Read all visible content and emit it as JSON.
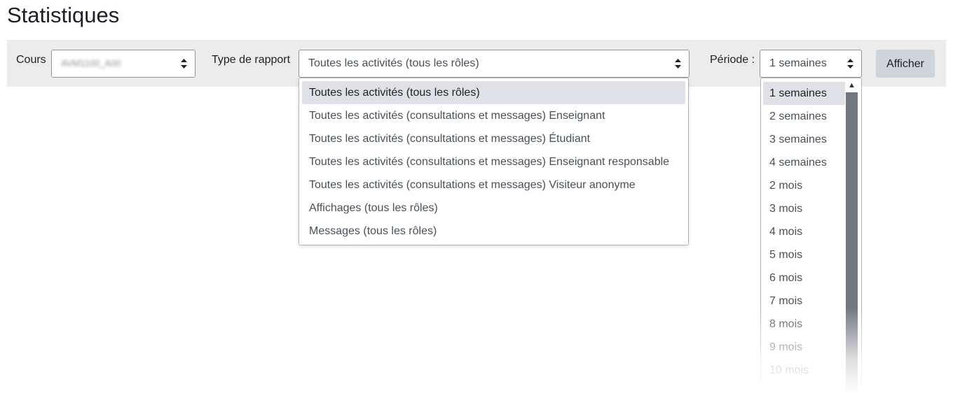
{
  "page": {
    "title": "Statistiques"
  },
  "form": {
    "course_label": "Cours",
    "course_value": "AVM1100_A00",
    "report_type_label": "Type de rapport",
    "report_type_value": "Toutes les activités (tous les rôles)",
    "period_label": "Période :",
    "period_value": "1 semaines",
    "submit_label": "Afficher"
  },
  "report_type_options": [
    "Toutes les activités (tous les rôles)",
    "Toutes les activités (consultations et messages) Enseignant",
    "Toutes les activités (consultations et messages) Étudiant",
    "Toutes les activités (consultations et messages) Enseignant responsable",
    "Toutes les activités (consultations et messages) Visiteur anonyme",
    "Affichages (tous les rôles)",
    "Messages (tous les rôles)"
  ],
  "period_options": [
    "1 semaines",
    "2 semaines",
    "3 semaines",
    "4 semaines",
    "2 mois",
    "3 mois",
    "4 mois",
    "5 mois",
    "6 mois",
    "7 mois",
    "8 mois",
    "9 mois",
    "10 mois"
  ],
  "icons": {
    "select_arrows": "sort-arrows-icon",
    "scroll_up": "scroll-up-icon"
  },
  "colors": {
    "toolbar_bg": "#ececec",
    "selected_option_bg": "#e0e1e6",
    "button_bg": "#ced4da",
    "scroll_thumb": "#727880"
  }
}
